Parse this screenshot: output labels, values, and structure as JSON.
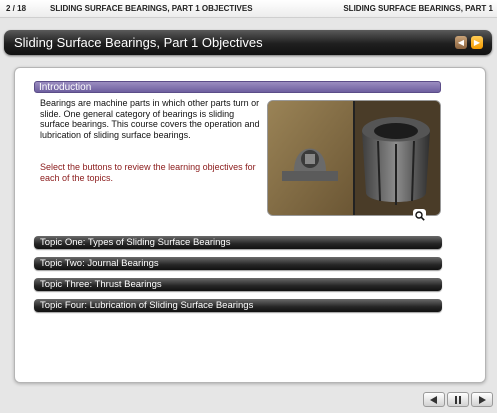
{
  "header": {
    "page_counter": "2 / 18",
    "module_title": "SLIDING SURFACE BEARINGS, PART 1 OBJECTIVES",
    "right_title": "SLIDING SURFACE BEARINGS, PART 1"
  },
  "titlebar": {
    "title": "Sliding Surface Bearings, Part 1 Objectives",
    "prev_icon": "chevron-left-icon",
    "next_icon": "play-icon",
    "prev_color": "#a57a52",
    "next_color": "#f7a81a"
  },
  "content": {
    "section_title": "Introduction",
    "intro_text": "Bearings are machine parts in which other parts turn or slide. One general category of bearings is sliding surface bearings. This course covers the operation and lubrication of sliding surface bearings.",
    "instruction_text": "Select the buttons to review the learning objectives for each of the topics.",
    "zoom_icon": "magnifier-icon",
    "accent_color": "#7a6aab",
    "instruction_color": "#8a1a1a"
  },
  "topics": [
    {
      "label": "Topic One: Types of Sliding Surface Bearings"
    },
    {
      "label": "Topic Two: Journal Bearings"
    },
    {
      "label": "Topic Three: Thrust Bearings"
    },
    {
      "label": "Topic Four: Lubrication of Sliding Surface Bearings"
    }
  ],
  "footer": {
    "prev_icon": "triangle-left-icon",
    "pause_icon": "pause-icon",
    "next_icon": "triangle-right-icon"
  }
}
